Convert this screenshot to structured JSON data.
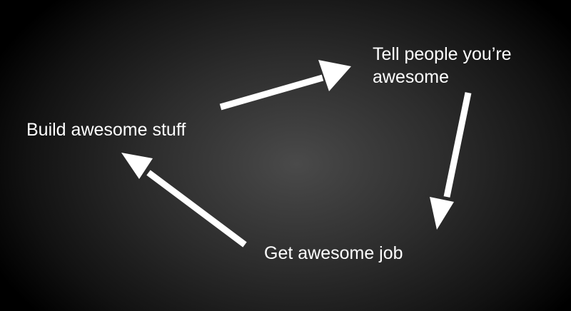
{
  "slide": {
    "steps": {
      "build": "Build awesome stuff",
      "tell_line1": "Tell people you’re",
      "tell_line2": "awesome",
      "job": "Get awesome job"
    },
    "colors": {
      "background_center": "#4a4a4a",
      "background_edge": "#000000",
      "text": "#ffffff",
      "arrow": "#ffffff"
    }
  }
}
